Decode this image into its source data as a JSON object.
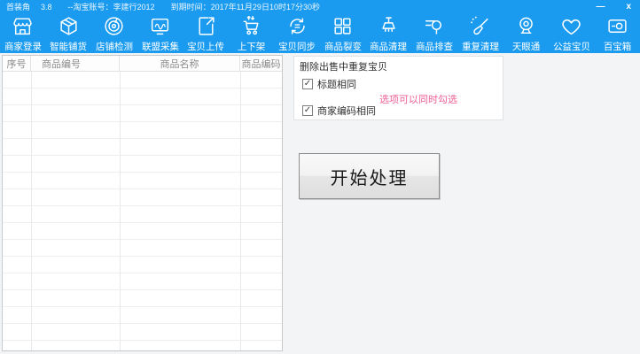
{
  "window": {
    "app_title": "首装角",
    "version": "3.8",
    "account": "--淘宝账号：李建行2012",
    "expire": "到期时间：2017年11月29日10时17分30秒",
    "minimize_glyph": "—",
    "close_glyph": "x"
  },
  "colors": {
    "accent_blue": "#1a9bf0",
    "hint_pink": "#ee5f96"
  },
  "toolbar": {
    "items": [
      {
        "label": "商家登录",
        "icon": "storefront-icon"
      },
      {
        "label": "智能铺货",
        "icon": "package-icon"
      },
      {
        "label": "店铺检测",
        "icon": "radar-icon"
      },
      {
        "label": "联盟采集",
        "icon": "monitor-wave-icon"
      },
      {
        "label": "宝贝上传",
        "icon": "upload-doc-icon"
      },
      {
        "label": "上下架",
        "icon": "cart-arrows-icon"
      },
      {
        "label": "宝贝同步",
        "icon": "sync-icon"
      },
      {
        "label": "商品裂变",
        "icon": "grid-icon"
      },
      {
        "label": "商品清理",
        "icon": "broom-icon"
      },
      {
        "label": "商品排查",
        "icon": "search-list-icon"
      },
      {
        "label": "重复清理",
        "icon": "brush-icon"
      },
      {
        "label": "天眼通",
        "icon": "webcam-icon"
      },
      {
        "label": "公益宝贝",
        "icon": "heart-icon"
      },
      {
        "label": "百宝箱",
        "icon": "treasure-box-icon"
      }
    ]
  },
  "table": {
    "columns": [
      "序号",
      "商品编号",
      "商品名称",
      "商品编码"
    ],
    "rows": []
  },
  "panel": {
    "group_title": "删除出售中重复宝贝",
    "checkbox_title_label": "标题相同",
    "checkbox_title_checked": true,
    "checkbox_code_label": "商家编码相同",
    "checkbox_code_checked": true,
    "check_glyph": "✓",
    "hint": "选项可以同时勾选",
    "start_button": "开始处理"
  }
}
